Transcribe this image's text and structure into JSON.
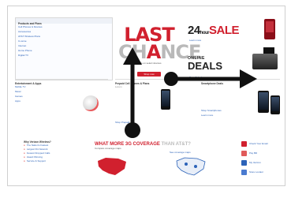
{
  "top_left_box": {
    "title": "Products and Plans",
    "links": [
      "Cell Phones & Devices",
      "Accessories",
      "AT&T Wireless Plans",
      "U-verse",
      "Internet",
      "Home Phone",
      "Digital TV"
    ]
  },
  "last_chance": {
    "line1": "LAST",
    "line2_a": "CH",
    "line2_b": "A",
    "line2_c": "NCE",
    "subtitle": "deals on select devices",
    "button": "Shop now"
  },
  "deals": {
    "hour_num": "24",
    "hour_text": "hour",
    "sale": "SALE",
    "online": "ONLINE",
    "deals": "DEALS",
    "sale_link": "Learn more",
    "deals_link": "See all deals",
    "bottom_link": "Shop Online Deals"
  },
  "mid_left": {
    "title": "Entertainment & Apps",
    "links": [
      "Mobile TV",
      "Music",
      "Games",
      "Apps"
    ]
  },
  "mid_center": {
    "title": "Prepaid Cell Phones & Plans",
    "link": "Shop Prepaid"
  },
  "mid_right": {
    "title": "Smartphone Deals",
    "links": [
      "Shop Smartphones",
      "Learn more"
    ]
  },
  "why_wireless": {
    "title": "Why Verizon Wireless?",
    "items": [
      "The Nation's Fastest",
      "Largest 3G Network",
      "Fewest Dropped Calls",
      "Award Winning",
      "Service & Support"
    ]
  },
  "coverage": {
    "title_red": "WHAT MORE 3G COVERAGE",
    "title_gray": "THAN AT&T?",
    "subtitle": "Compare coverage maps",
    "link": "See coverage maps"
  },
  "right_links": {
    "items": [
      "Check Your Email",
      "Pay Bill",
      "My Verizon",
      "Store Locator"
    ]
  },
  "colors": {
    "brand_red": "#d1202e",
    "link_blue": "#2b62b8",
    "arrow": "#111111"
  },
  "annotation_arrows": [
    "arrow-up",
    "arrow-right"
  ]
}
